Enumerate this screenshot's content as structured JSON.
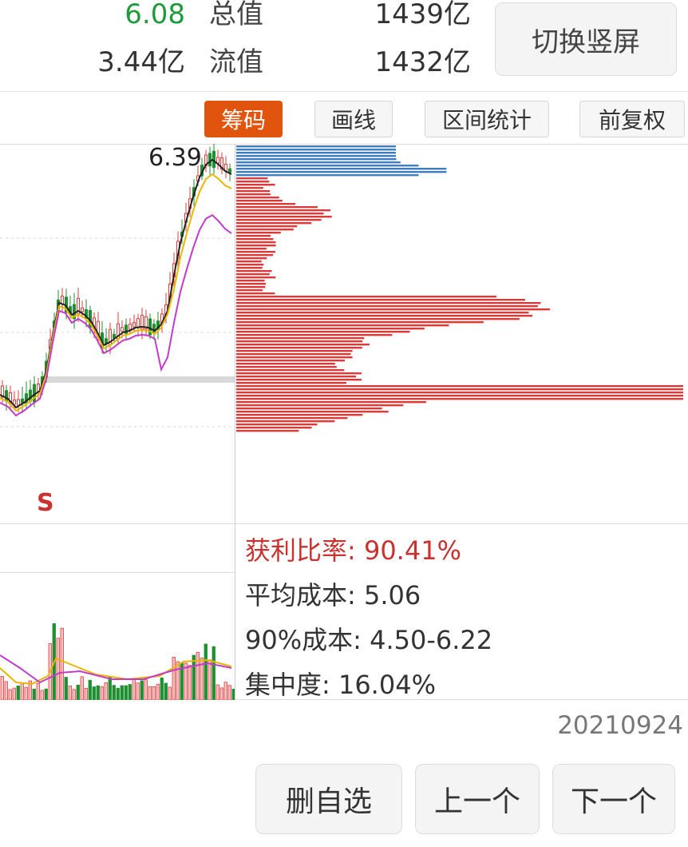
{
  "stats": {
    "row1": {
      "value": "6.08",
      "label": "总值",
      "value2": "1439亿"
    },
    "row2": {
      "value": "3.44亿",
      "label": "流值",
      "value2": "1432亿"
    },
    "switch_label": "切换竖屏"
  },
  "toolbar": {
    "chips_label": "筹码",
    "draw_label": "画线",
    "range_label": "区间统计",
    "adjust_label": "前复权"
  },
  "chart": {
    "price_marker": "6.39",
    "sell_marker": "S",
    "colors": {
      "up": "#e23b3b",
      "down": "#1f8f32",
      "ma5": "#222222",
      "ma10": "#e8b600",
      "ma20": "#c23bc9",
      "chips_profit": "#d93a3a",
      "chips_loss": "#3f7cc2"
    }
  },
  "chip_stats": {
    "profit_ratio": "获利比率: 90.41%",
    "avg_cost": "平均成本: 5.06",
    "cost_90": "90%成本:  4.50-6.22",
    "concentration": "集中度: 16.04%"
  },
  "date": "20210924",
  "actions": {
    "remove_label": "删自选",
    "prev_label": "上一个",
    "next_label": "下一个"
  }
}
